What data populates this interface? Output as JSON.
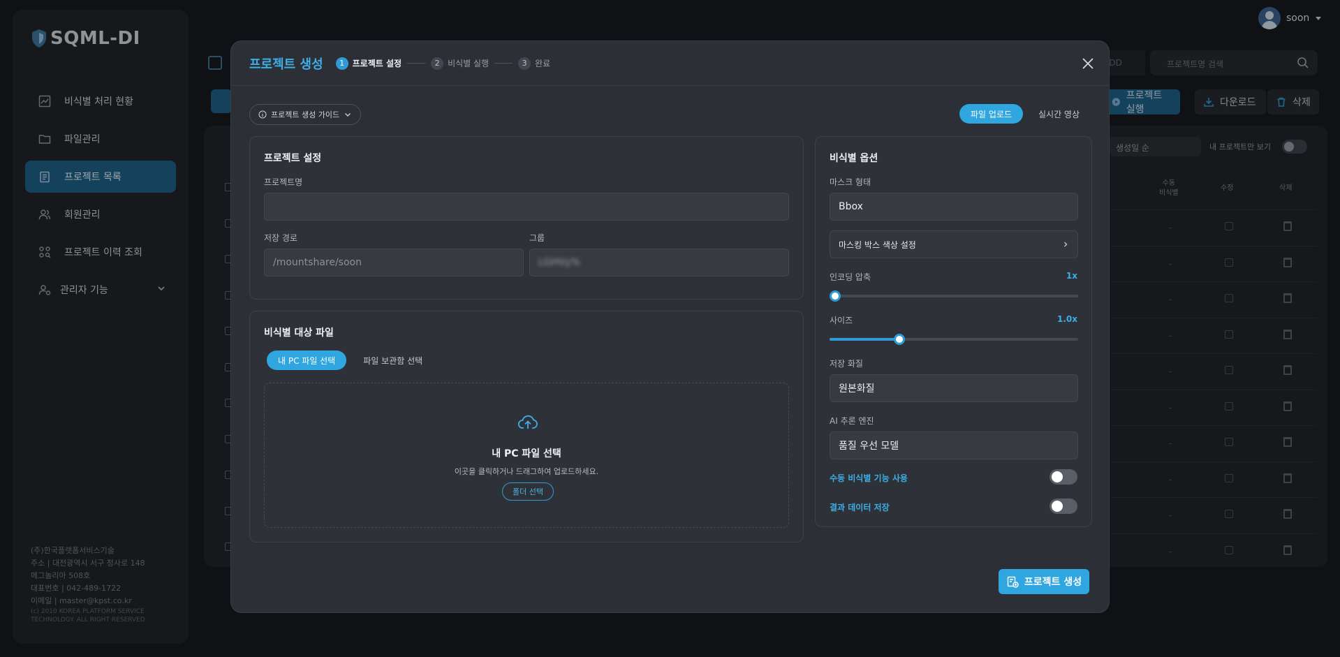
{
  "app": {
    "logo_text": "SQML-DI",
    "user_name": "soon"
  },
  "sidebar": {
    "items": [
      {
        "label": "비식별 처리 현황",
        "icon": "chart-icon"
      },
      {
        "label": "파일관리",
        "icon": "folder-icon"
      },
      {
        "label": "프로젝트 목록",
        "icon": "clipboard-icon",
        "active": true
      },
      {
        "label": "회원관리",
        "icon": "users-icon"
      },
      {
        "label": "프로젝트 이력 조회",
        "icon": "history-icon"
      },
      {
        "label": "관리자 기능",
        "icon": "admin-icon",
        "expandable": true
      }
    ],
    "footer": {
      "company": "(주)한국플랫폼서비스기술",
      "address1": "주소 | 대전광역시 서구 청사로 148",
      "address2": "메그놀리아 508호",
      "phone": "대표번호 | 042-489-1722",
      "email": "이메일 | master@kpst.co.kr",
      "copyright1": "(c) 2010 KOREA PLATFORM SERVICE",
      "copyright2": "TECHNOLOGY. ALL RIGHT RESERVED"
    }
  },
  "background": {
    "date_placeholder": "-DD",
    "search_placeholder": "프로젝트명 검색",
    "run_button": "프로젝트 실행",
    "download_button": "다운로드",
    "delete_button": "삭제",
    "sort_value": "생성일 순",
    "mine_only_label": "내 프로젝트만 보기",
    "col_manual_line1": "수동",
    "col_manual_line2": "비식별",
    "col_edit": "수정",
    "col_delete": "삭제",
    "row_dash": "-"
  },
  "modal": {
    "title": "프로젝트 생성",
    "steps": [
      {
        "num": "1",
        "label": "프로젝트 설정",
        "active": true
      },
      {
        "num": "2",
        "label": "비식별 실행"
      },
      {
        "num": "3",
        "label": "완료"
      }
    ],
    "guide_label": "프로젝트 생성 가이드",
    "source_tabs": [
      {
        "label": "파일 업로드",
        "active": true
      },
      {
        "label": "실시간 영상"
      }
    ],
    "project_settings": {
      "title": "프로젝트 설정",
      "name_label": "프로젝트명",
      "name_value": "",
      "path_label": "저장 경로",
      "path_value": "/mountshare/soon",
      "group_label": "그룹",
      "group_value": "LGHVy%"
    },
    "target_files": {
      "title": "비식별 대상 파일",
      "tabs": [
        {
          "label": "내 PC 파일 선택",
          "active": true
        },
        {
          "label": "파일 보관함 선택"
        }
      ],
      "drop_title": "내 PC 파일 선택",
      "drop_sub": "이곳을 클릭하거나 드래그하여 업로드하세요.",
      "folder_button": "폴더 선택"
    },
    "options": {
      "title": "비식별 옵션",
      "mask_label": "마스크 형태",
      "mask_value": "Bbox",
      "color_setting": "마스킹 박스 색상 설정",
      "encoding_label": "인코딩 압축",
      "encoding_value": "1x",
      "encoding_fraction": 0.0,
      "size_label": "사이즈",
      "size_value": "1.0x",
      "size_fraction": 0.28,
      "quality_label": "저장 화질",
      "quality_value": "원본화질",
      "engine_label": "AI 추론 엔진",
      "engine_value": "품질 우선 모델",
      "manual_label": "수동 비식별 기능 사용",
      "manual_on": false,
      "save_result_label": "결과 데이터 저장",
      "save_result_on": false
    },
    "create_button": "프로젝트 생성"
  },
  "colors": {
    "accent": "#2fa6e0",
    "modal_bg": "#2c2f35",
    "page_bg": "#16181c"
  }
}
